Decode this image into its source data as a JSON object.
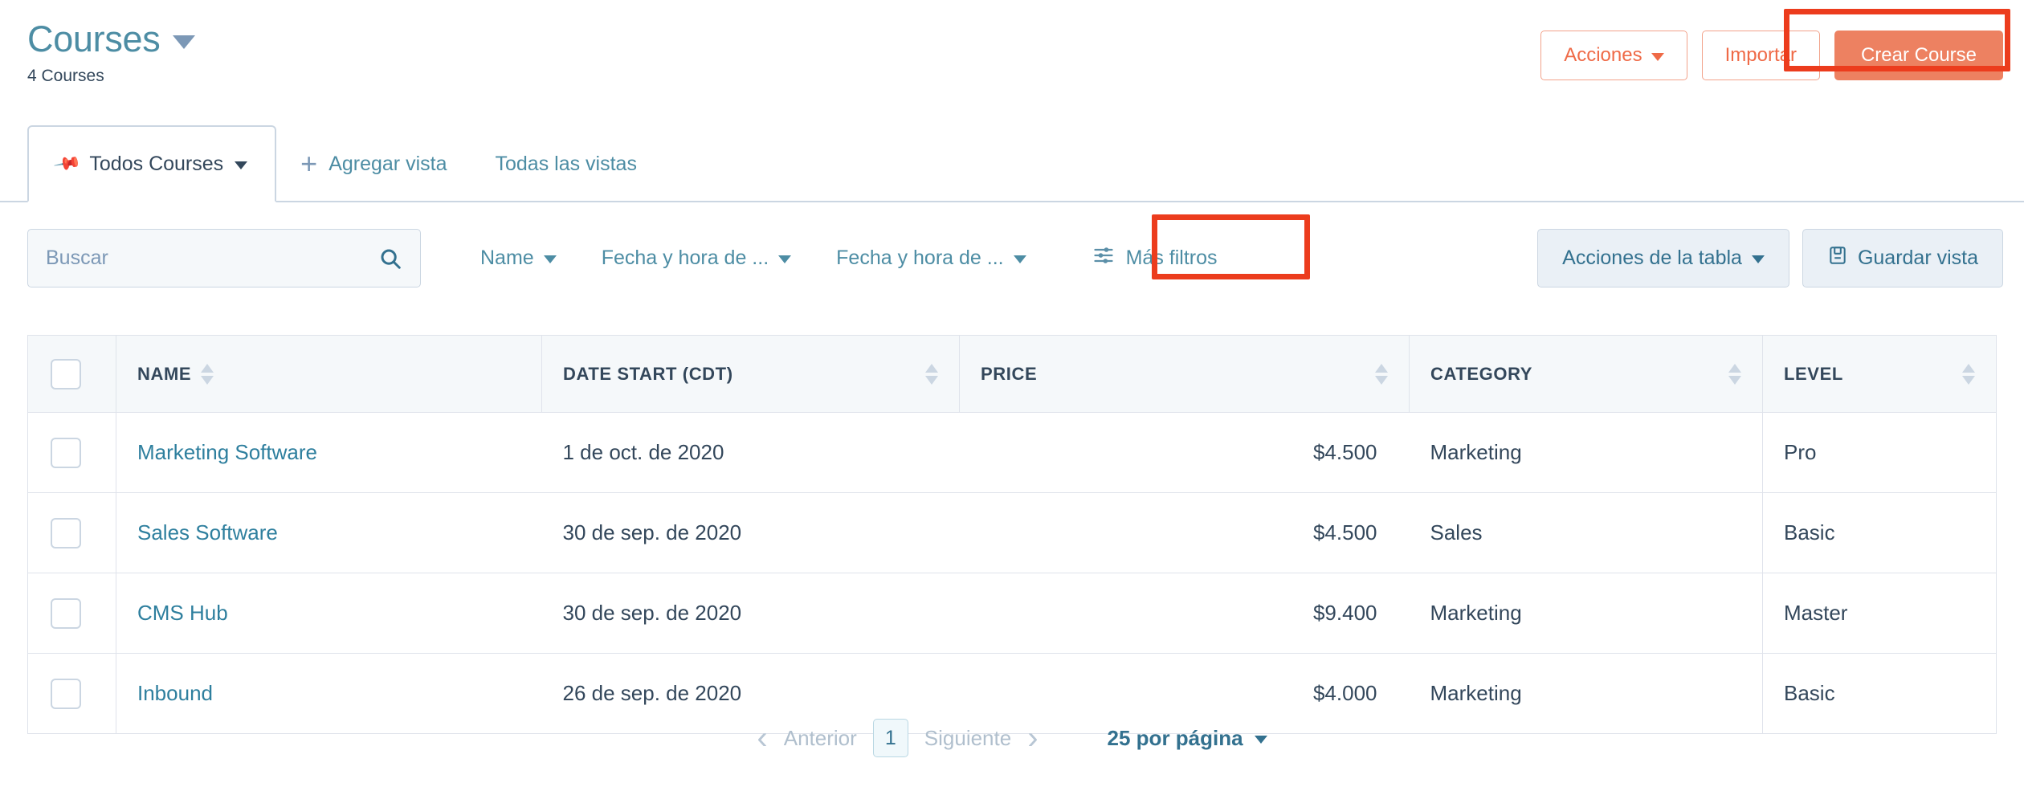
{
  "header": {
    "title": "Courses",
    "subtitle": "4 Courses",
    "title_caret_icon": "chevron-down-icon",
    "actions": {
      "acciones_label": "Acciones",
      "importar_label": "Importar",
      "crear_label": "Crear Course"
    }
  },
  "tabs": {
    "active": {
      "label": "Todos Courses",
      "pin_icon": "pin-icon",
      "caret_icon": "chevron-down-icon"
    },
    "add_view_label": "Agregar vista",
    "add_view_icon": "plus-icon",
    "all_views_label": "Todas las vistas"
  },
  "filters": {
    "search": {
      "placeholder": "Buscar",
      "value": "",
      "icon": "search-icon"
    },
    "dropdowns": [
      {
        "label": "Name"
      },
      {
        "label": "Fecha y hora de ..."
      },
      {
        "label": "Fecha y hora de ..."
      }
    ],
    "more_filters_label": "Más filtros",
    "more_filters_icon": "sliders-icon",
    "table_actions_label": "Acciones de la tabla",
    "save_view_label": "Guardar vista",
    "save_view_icon": "floppy-disk-icon"
  },
  "table": {
    "columns": [
      {
        "key": "name",
        "label": "NAME"
      },
      {
        "key": "date",
        "label": "DATE START (CDT)"
      },
      {
        "key": "price",
        "label": "PRICE"
      },
      {
        "key": "category",
        "label": "CATEGORY"
      },
      {
        "key": "level",
        "label": "LEVEL"
      }
    ],
    "rows": [
      {
        "name": "Marketing Software",
        "date": "1 de oct. de 2020",
        "price": "$4.500",
        "category": "Marketing",
        "level": "Pro"
      },
      {
        "name": "Sales Software",
        "date": "30 de sep. de 2020",
        "price": "$4.500",
        "category": "Sales",
        "level": "Basic"
      },
      {
        "name": "CMS Hub",
        "date": "30 de sep. de 2020",
        "price": "$9.400",
        "category": "Marketing",
        "level": "Master"
      },
      {
        "name": "Inbound",
        "date": "26 de sep. de 2020",
        "price": "$4.000",
        "category": "Marketing",
        "level": "Basic"
      }
    ]
  },
  "pagination": {
    "prev_label": "Anterior",
    "next_label": "Siguiente",
    "current_page": "1",
    "per_page_label": "25 por página",
    "prev_icon": "chevron-left-icon",
    "next_icon": "chevron-right-icon"
  },
  "colors": {
    "brand_orange": "#ed8161",
    "orange_text": "#ef6a47",
    "highlight_red": "#ec3c1d",
    "link_blue": "#2e7f9e",
    "title_blue": "#4d8da4",
    "text_dark": "#33475b",
    "border_grey": "#dfe3eb",
    "header_bg": "#f5f8fa"
  }
}
